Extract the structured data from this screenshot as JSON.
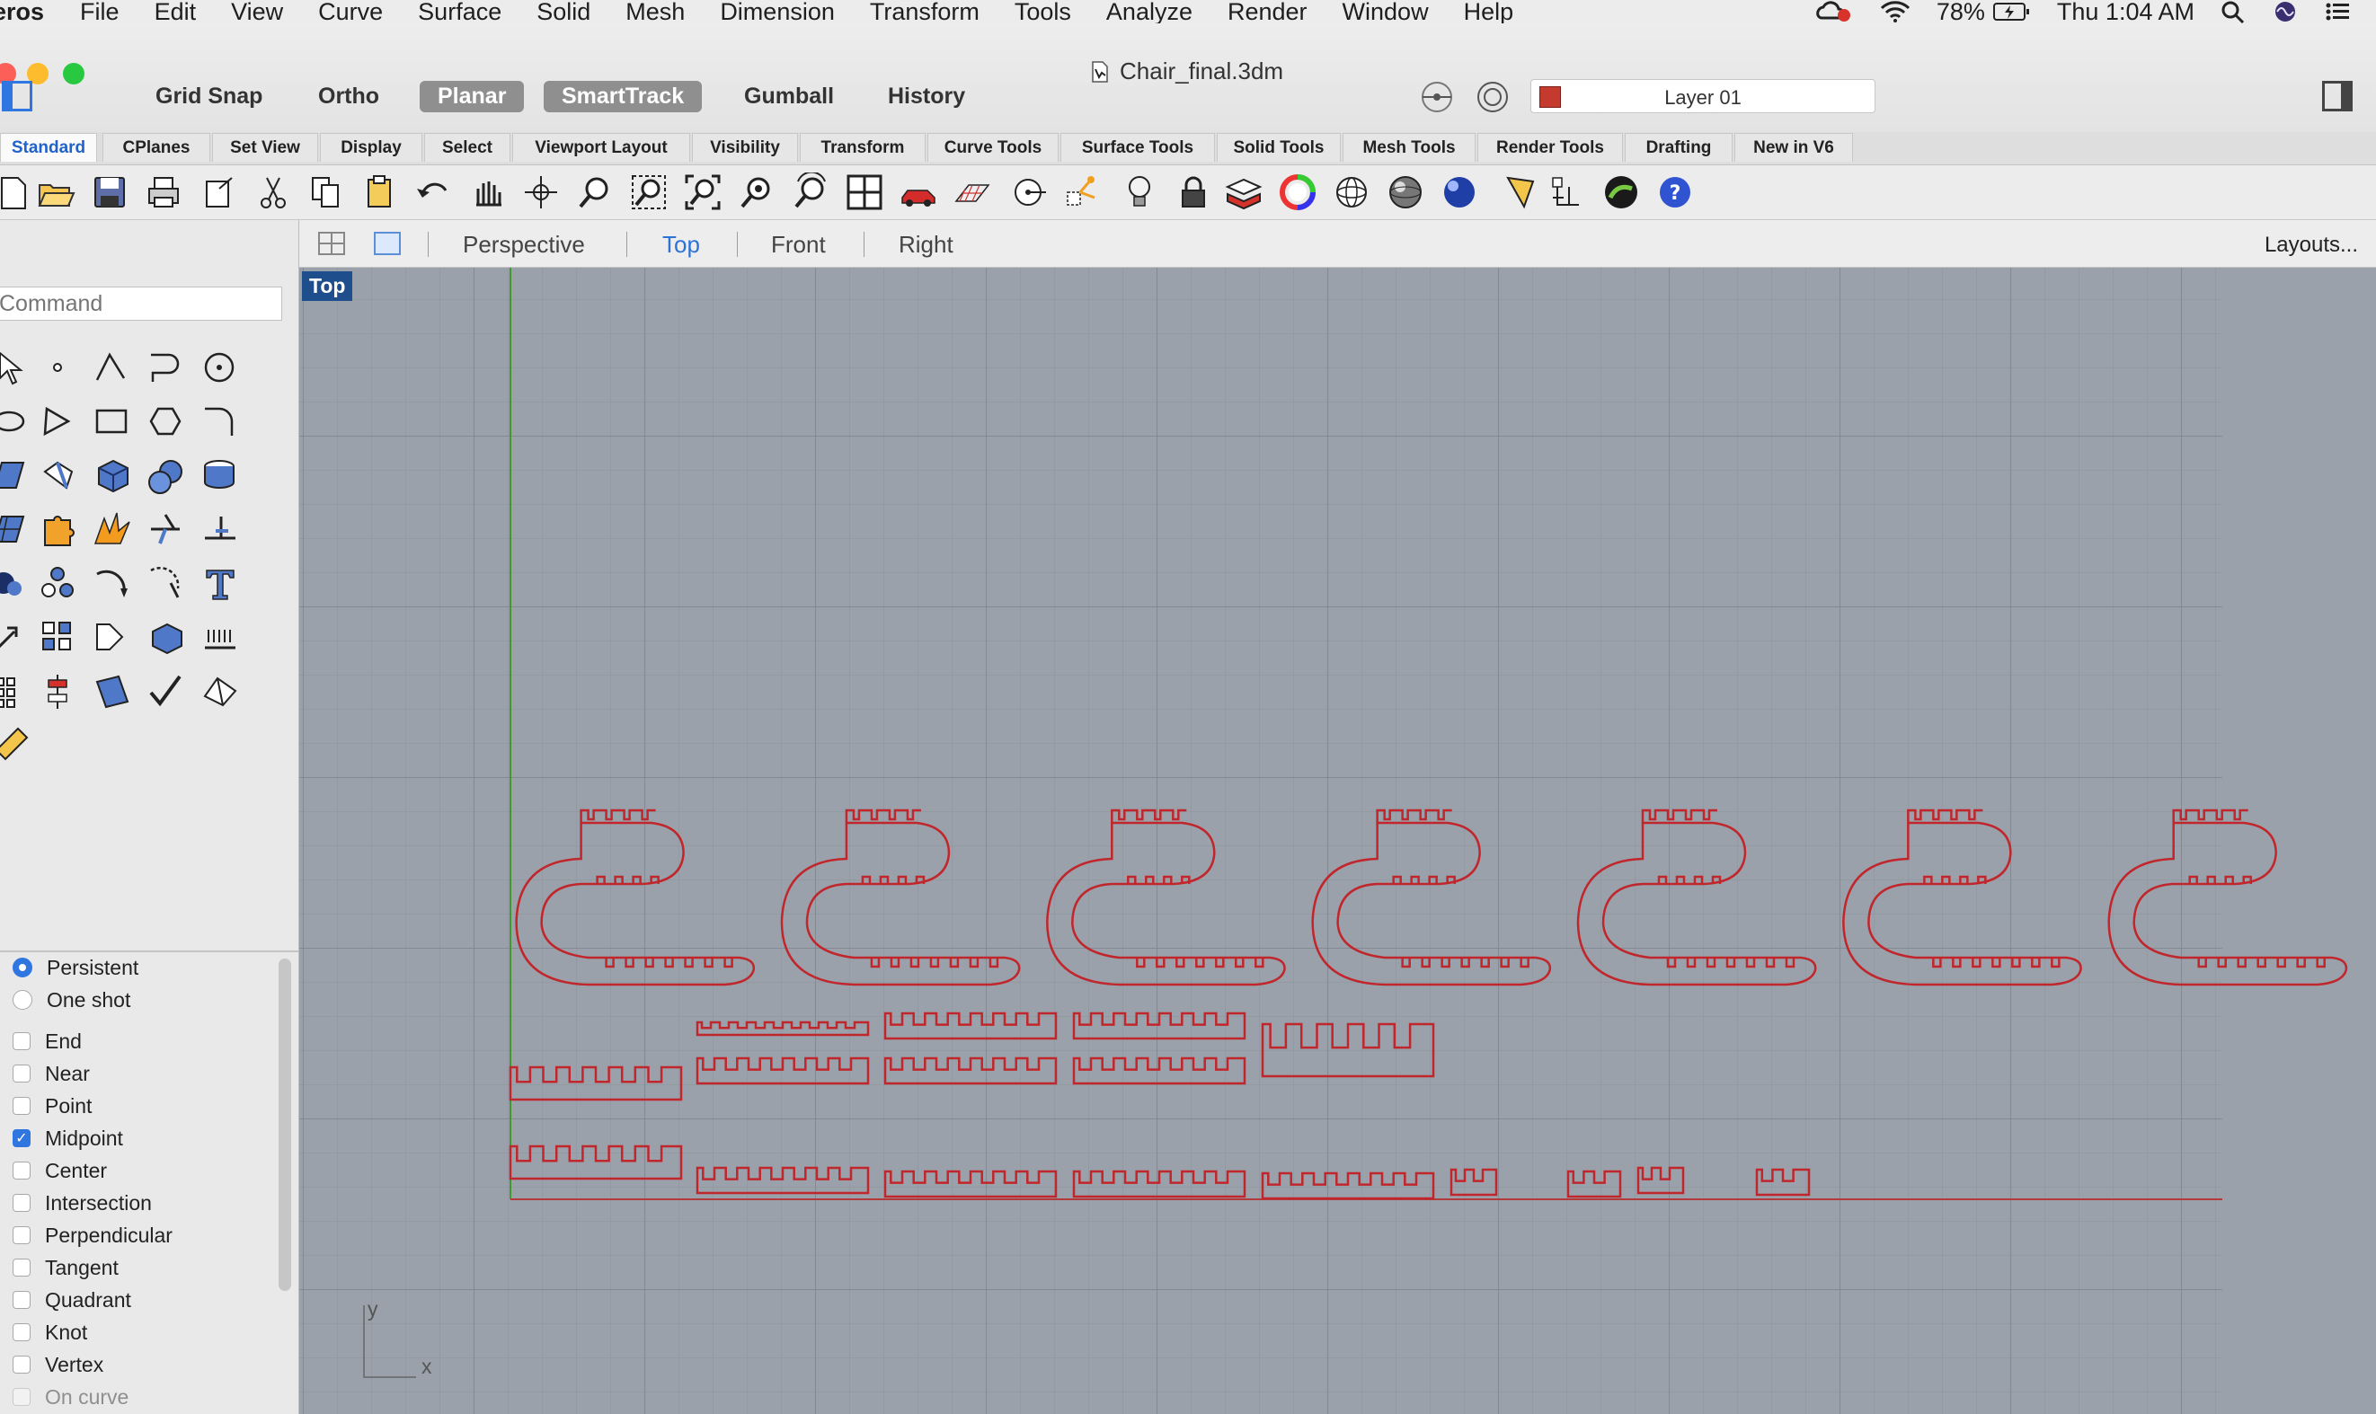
{
  "menubar": {
    "app_name": "eros",
    "items": [
      "File",
      "Edit",
      "View",
      "Curve",
      "Surface",
      "Solid",
      "Mesh",
      "Dimension",
      "Transform",
      "Tools",
      "Analyze",
      "Render",
      "Window",
      "Help"
    ],
    "battery": "78%",
    "clock": "Thu 1:04 AM"
  },
  "window": {
    "title": "Chair_final.3dm"
  },
  "toggles": {
    "grid_snap": "Grid Snap",
    "ortho": "Ortho",
    "planar": "Planar",
    "smarttrack": "SmartTrack",
    "gumball": "Gumball",
    "history": "History"
  },
  "layer": {
    "name": "Layer 01",
    "color": "#c53a2e"
  },
  "tabs": [
    "Standard",
    "CPlanes",
    "Set View",
    "Display",
    "Select",
    "Viewport Layout",
    "Visibility",
    "Transform",
    "Curve Tools",
    "Surface Tools",
    "Solid Tools",
    "Mesh Tools",
    "Render Tools",
    "Drafting",
    "New in V6"
  ],
  "active_tab": "Standard",
  "command": {
    "placeholder": "Command"
  },
  "viewport_tabs": {
    "perspective": "Perspective",
    "top": "Top",
    "front": "Front",
    "right": "Right",
    "layouts": "Layouts...",
    "active": "Top"
  },
  "viewport": {
    "label": "Top",
    "axis_y": "y",
    "axis_x": "x",
    "curve_color": "#c0262b",
    "background": "#9aa1aa"
  },
  "osnap": {
    "mode_persistent": "Persistent",
    "mode_one_shot": "One shot",
    "selected_mode": "Persistent",
    "items": [
      {
        "label": "End",
        "checked": false
      },
      {
        "label": "Near",
        "checked": false
      },
      {
        "label": "Point",
        "checked": false
      },
      {
        "label": "Midpoint",
        "checked": true
      },
      {
        "label": "Center",
        "checked": false
      },
      {
        "label": "Intersection",
        "checked": false
      },
      {
        "label": "Perpendicular",
        "checked": false
      },
      {
        "label": "Tangent",
        "checked": false
      },
      {
        "label": "Quadrant",
        "checked": false
      },
      {
        "label": "Knot",
        "checked": false
      },
      {
        "label": "Vertex",
        "checked": false
      },
      {
        "label": "On curve",
        "checked": false
      }
    ]
  }
}
